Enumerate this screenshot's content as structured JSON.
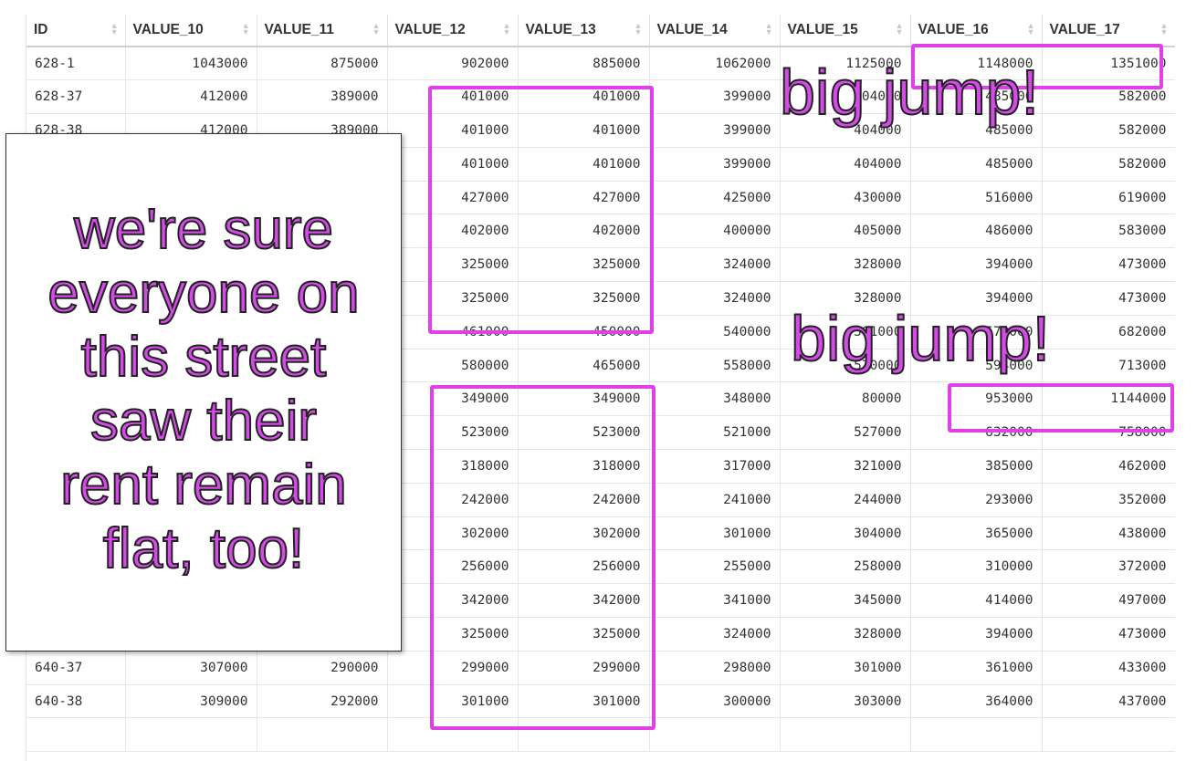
{
  "table": {
    "columns": [
      "ID",
      "VALUE_10",
      "VALUE_11",
      "VALUE_12",
      "VALUE_13",
      "VALUE_14",
      "VALUE_15",
      "VALUE_16",
      "VALUE_17"
    ],
    "rows": [
      [
        "628-1",
        "1043000",
        "875000",
        "902000",
        "885000",
        "1062000",
        "1125000",
        "1148000",
        "1351000"
      ],
      [
        "628-37",
        "412000",
        "389000",
        "401000",
        "401000",
        "399000",
        "404000",
        "485000",
        "582000"
      ],
      [
        "628-38",
        "412000",
        "389000",
        "401000",
        "401000",
        "399000",
        "404000",
        "485000",
        "582000"
      ],
      [
        "",
        "",
        "",
        "401000",
        "401000",
        "399000",
        "404000",
        "485000",
        "582000"
      ],
      [
        "",
        "",
        "",
        "427000",
        "427000",
        "425000",
        "430000",
        "516000",
        "619000"
      ],
      [
        "",
        "",
        "",
        "402000",
        "402000",
        "400000",
        "405000",
        "486000",
        "583000"
      ],
      [
        "",
        "",
        "",
        "325000",
        "325000",
        "324000",
        "328000",
        "394000",
        "473000"
      ],
      [
        "",
        "",
        "",
        "325000",
        "325000",
        "324000",
        "328000",
        "394000",
        "473000"
      ],
      [
        "",
        "",
        "",
        "461000",
        "450000",
        "540000",
        "501000",
        "570000",
        "682000"
      ],
      [
        "",
        "",
        "",
        "580000",
        "465000",
        "558000",
        "570000",
        "594000",
        "713000"
      ],
      [
        "",
        "",
        "",
        "349000",
        "349000",
        "348000",
        "80000",
        "953000",
        "1144000"
      ],
      [
        "",
        "",
        "",
        "523000",
        "523000",
        "521000",
        "527000",
        "632000",
        "758000"
      ],
      [
        "",
        "",
        "",
        "318000",
        "318000",
        "317000",
        "321000",
        "385000",
        "462000"
      ],
      [
        "",
        "",
        "",
        "242000",
        "242000",
        "241000",
        "244000",
        "293000",
        "352000"
      ],
      [
        "",
        "",
        "",
        "302000",
        "302000",
        "301000",
        "304000",
        "365000",
        "438000"
      ],
      [
        "",
        "",
        "",
        "256000",
        "256000",
        "255000",
        "258000",
        "310000",
        "372000"
      ],
      [
        "",
        "",
        "",
        "342000",
        "342000",
        "341000",
        "345000",
        "414000",
        "497000"
      ],
      [
        "640-36",
        "334000",
        "315000",
        "325000",
        "325000",
        "324000",
        "328000",
        "394000",
        "473000"
      ],
      [
        "640-37",
        "307000",
        "290000",
        "299000",
        "299000",
        "298000",
        "301000",
        "361000",
        "433000"
      ],
      [
        "640-38",
        "309000",
        "292000",
        "301000",
        "301000",
        "300000",
        "303000",
        "364000",
        "437000"
      ],
      [
        "",
        "",
        "",
        "",
        "",
        "",
        "",
        "",
        ""
      ]
    ]
  },
  "annotations": {
    "callout_lines": [
      "we're sure",
      "everyone on",
      "this street",
      "saw their",
      "rent remain",
      "flat, too!"
    ],
    "jump_label_1": "big jump!",
    "jump_label_2": "big jump!",
    "highlight_color": "#e040e8",
    "text_color": "#d54be8"
  },
  "icons": {
    "sort": "sort-icon"
  }
}
